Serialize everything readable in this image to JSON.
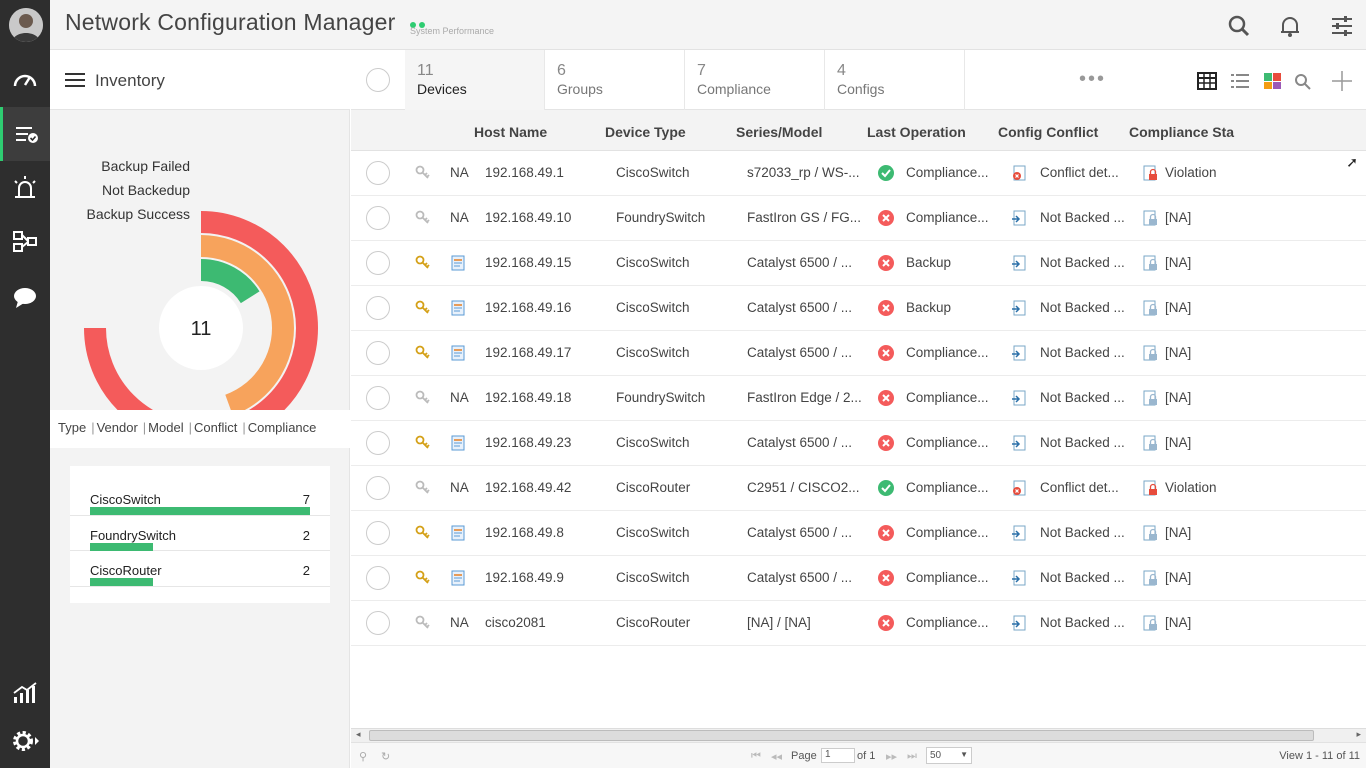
{
  "app": {
    "title": "Network Configuration Manager",
    "sys_perf": "System Performance"
  },
  "left": {
    "title": "Inventory",
    "donut": {
      "total": "11",
      "legend": [
        {
          "label": "Backup Failed",
          "color": "#f45b5b"
        },
        {
          "label": "Not Backedup",
          "color": "#f7a35c"
        },
        {
          "label": "Backup Success",
          "color": "#3dba72"
        }
      ]
    },
    "tabs": [
      "Type",
      "Vendor",
      "Model",
      "Conflict",
      "Compliance"
    ],
    "types": [
      {
        "name": "CiscoSwitch",
        "count": "7",
        "value": 7
      },
      {
        "name": "FoundrySwitch",
        "count": "2",
        "value": 2
      },
      {
        "name": "CiscoRouter",
        "count": "2",
        "value": 2
      }
    ]
  },
  "tabs": [
    {
      "count": "11",
      "label": "Devices"
    },
    {
      "count": "6",
      "label": "Groups"
    },
    {
      "count": "7",
      "label": "Compliance"
    },
    {
      "count": "4",
      "label": "Configs"
    }
  ],
  "more": "•••",
  "columns": [
    "Host Name",
    "Device Type",
    "Series/Model",
    "Last Operation",
    "Config Conflict",
    "Compliance Sta"
  ],
  "rows": [
    {
      "na": "NA",
      "host": "192.168.49.1",
      "type": "CiscoSwitch",
      "model": "s72033_rp / WS-...",
      "op": "Compliance...",
      "op_ok": true,
      "conflict": "Conflict det...",
      "conf_red": true,
      "comp": "Violation",
      "comp_red": true
    },
    {
      "na": "NA",
      "host": "192.168.49.10",
      "type": "FoundrySwitch",
      "model": "FastIron GS / FG...",
      "op": "Compliance...",
      "op_ok": false,
      "conflict": "Not Backed ...",
      "conf_red": false,
      "comp": "[NA]",
      "comp_red": false
    },
    {
      "na": "",
      "host": "192.168.49.15",
      "type": "CiscoSwitch",
      "model": "Catalyst 6500 / ...",
      "op": "Backup",
      "op_ok": false,
      "conflict": "Not Backed ...",
      "conf_red": false,
      "comp": "[NA]",
      "comp_red": false
    },
    {
      "na": "",
      "host": "192.168.49.16",
      "type": "CiscoSwitch",
      "model": "Catalyst 6500 / ...",
      "op": "Backup",
      "op_ok": false,
      "conflict": "Not Backed ...",
      "conf_red": false,
      "comp": "[NA]",
      "comp_red": false
    },
    {
      "na": "",
      "host": "192.168.49.17",
      "type": "CiscoSwitch",
      "model": "Catalyst 6500 / ...",
      "op": "Compliance...",
      "op_ok": false,
      "conflict": "Not Backed ...",
      "conf_red": false,
      "comp": "[NA]",
      "comp_red": false
    },
    {
      "na": "NA",
      "host": "192.168.49.18",
      "type": "FoundrySwitch",
      "model": "FastIron Edge / 2...",
      "op": "Compliance...",
      "op_ok": false,
      "conflict": "Not Backed ...",
      "conf_red": false,
      "comp": "[NA]",
      "comp_red": false
    },
    {
      "na": "",
      "host": "192.168.49.23",
      "type": "CiscoSwitch",
      "model": "Catalyst 6500 / ...",
      "op": "Compliance...",
      "op_ok": false,
      "conflict": "Not Backed ...",
      "conf_red": false,
      "comp": "[NA]",
      "comp_red": false
    },
    {
      "na": "NA",
      "host": "192.168.49.42",
      "type": "CiscoRouter",
      "model": "C2951 / CISCO2...",
      "op": "Compliance...",
      "op_ok": true,
      "conflict": "Conflict det...",
      "conf_red": true,
      "comp": "Violation",
      "comp_red": true
    },
    {
      "na": "",
      "host": "192.168.49.8",
      "type": "CiscoSwitch",
      "model": "Catalyst 6500 / ...",
      "op": "Compliance...",
      "op_ok": false,
      "conflict": "Not Backed ...",
      "conf_red": false,
      "comp": "[NA]",
      "comp_red": false
    },
    {
      "na": "",
      "host": "192.168.49.9",
      "type": "CiscoSwitch",
      "model": "Catalyst 6500 / ...",
      "op": "Compliance...",
      "op_ok": false,
      "conflict": "Not Backed ...",
      "conf_red": false,
      "comp": "[NA]",
      "comp_red": false
    },
    {
      "na": "NA",
      "host": "cisco2081",
      "type": "CiscoRouter",
      "model": "[NA] / [NA]",
      "op": "Compliance...",
      "op_ok": false,
      "conflict": "Not Backed ...",
      "conf_red": false,
      "comp": "[NA]",
      "comp_red": false
    }
  ],
  "pager": {
    "page_label": "Page",
    "page_value": "1",
    "of": "of 1",
    "per_page": "50",
    "view": "View 1 - 11 of 11"
  },
  "colors": {
    "green": "#3dba72",
    "orange": "#f7a35c",
    "red": "#f45b5b",
    "rail": "#2e2e2e"
  }
}
